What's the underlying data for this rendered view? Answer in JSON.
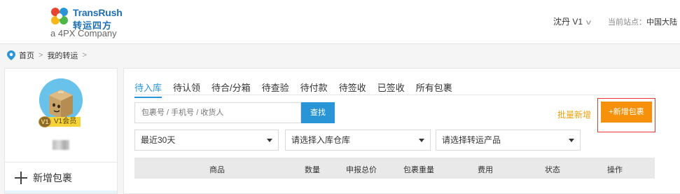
{
  "header": {
    "logo_brand": "TransRush",
    "logo_cn": "转运四方",
    "logo_sub": "a 4PX Company",
    "user_name": "沈丹 V1",
    "site_label": "当前站点：",
    "site_value": "中国大陆"
  },
  "breadcrumb": {
    "home": "首页",
    "current": "我的转运"
  },
  "sidebar": {
    "member_badge": "V1",
    "member_label": "V1会员",
    "add_package": "新增包裹"
  },
  "tabs": [
    {
      "label": "待入库",
      "active": true
    },
    {
      "label": "待认领"
    },
    {
      "label": "待合/分箱"
    },
    {
      "label": "待查验"
    },
    {
      "label": "待付款"
    },
    {
      "label": "待签收"
    },
    {
      "label": "已签收"
    },
    {
      "label": "所有包裹"
    }
  ],
  "search": {
    "placeholder": "包裹号 / 手机号 / 收货人",
    "button": "查找"
  },
  "actions": {
    "batch_add": "批量新增",
    "new_package": "+新增包裹"
  },
  "filters": {
    "date_range": "最近30天",
    "warehouse": "请选择入库仓库",
    "product": "请选择转运产品"
  },
  "table": {
    "columns": [
      "商品",
      "数量",
      "申报总价",
      "包裹重量",
      "费用",
      "状态",
      "操作"
    ]
  },
  "colors": {
    "accent": "#2a95d6",
    "orange": "#f7910a",
    "batch": "#f0a10c"
  }
}
